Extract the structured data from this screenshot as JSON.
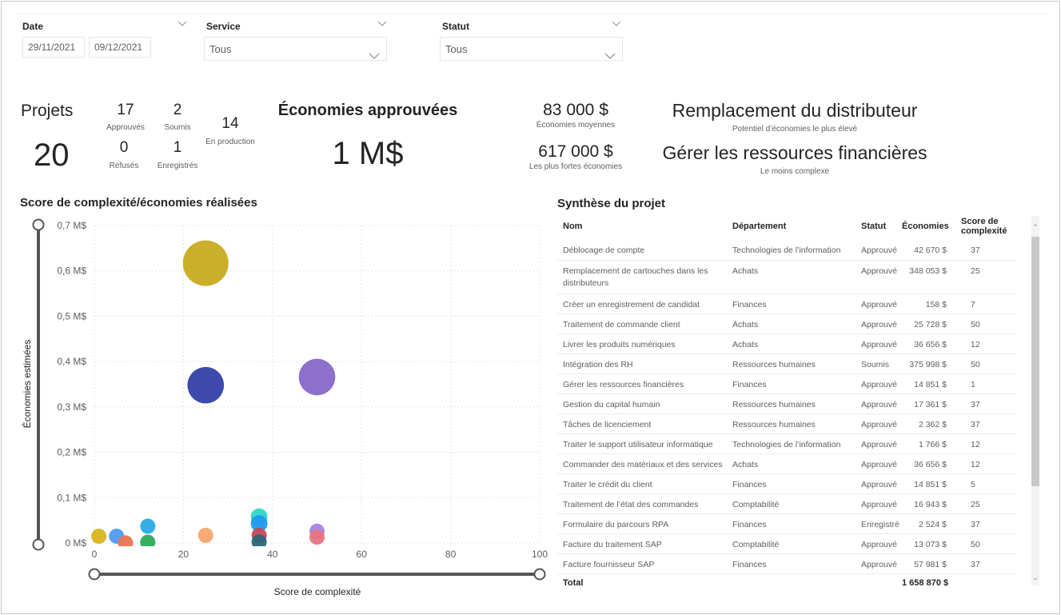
{
  "filters": {
    "date": {
      "title": "Date",
      "start": "29/11/2021",
      "end": "09/12/2021"
    },
    "service": {
      "title": "Service",
      "value": "Tous"
    },
    "statut": {
      "title": "Statut",
      "value": "Tous"
    }
  },
  "kpis": {
    "projets_label": "Projets",
    "projets_total": "20",
    "approuves": {
      "value": "17",
      "label": "Approuvés"
    },
    "soumis": {
      "value": "2",
      "label": "Soumis"
    },
    "refuses": {
      "value": "0",
      "label": "Refusés"
    },
    "enregistres": {
      "value": "1",
      "label": "Enregistrés"
    },
    "en_production": {
      "value": "14",
      "label": "En production"
    },
    "economies_title": "Économies approuvées",
    "economies_value": "1 M$",
    "moyennes": {
      "value": "83 000 $",
      "label": "Économies moyennes"
    },
    "plus_fortes": {
      "value": "617 000 $",
      "label": "Les plus fortes économies"
    },
    "top_potential": {
      "value": "Remplacement du distributeur",
      "label": "Potentiel d’économies le plus élevé"
    },
    "least_complex": {
      "value": "Gérer les ressources financières",
      "label": "Le moins complexe"
    }
  },
  "chart_data": {
    "type": "scatter",
    "title": "Score de complexité/économies réalisées",
    "xlabel": "Score de complexité",
    "ylabel": "Économies estimées",
    "xlim": [
      0,
      100
    ],
    "ylim": [
      0,
      0.7
    ],
    "x_ticks": [
      "0",
      "20",
      "40",
      "60",
      "80",
      "100"
    ],
    "y_ticks": [
      "0 M$",
      "0,1 M$",
      "0,2 M$",
      "0,3 M$",
      "0,4 M$",
      "0,5 M$",
      "0,6 M$",
      "0,7 M$"
    ],
    "grid": true,
    "legend": "none",
    "points": [
      {
        "x": 25,
        "y": 0.617,
        "size": 3,
        "color": "#C8AA1E"
      },
      {
        "x": 25,
        "y": 0.348,
        "size": 2.4,
        "color": "#3340A8"
      },
      {
        "x": 50,
        "y": 0.366,
        "size": 2.4,
        "color": "#8767C9"
      },
      {
        "x": 1,
        "y": 0.015,
        "size": 1,
        "color": "#D9B41E"
      },
      {
        "x": 5,
        "y": 0.015,
        "size": 1,
        "color": "#4E9BF0"
      },
      {
        "x": 7,
        "y": 0.0002,
        "size": 1,
        "color": "#E97552"
      },
      {
        "x": 12,
        "y": 0.037,
        "size": 1,
        "color": "#2AAAE3"
      },
      {
        "x": 12,
        "y": 0.0017,
        "size": 1,
        "color": "#2EAA5A"
      },
      {
        "x": 25,
        "y": 0.017,
        "size": 1,
        "color": "#F6A66D"
      },
      {
        "x": 37,
        "y": 0.058,
        "size": 1.1,
        "color": "#2BD7C3"
      },
      {
        "x": 37,
        "y": 0.043,
        "size": 1.1,
        "color": "#1C9BF0"
      },
      {
        "x": 37,
        "y": 0.017,
        "size": 1,
        "color": "#C8485A"
      },
      {
        "x": 37,
        "y": 0.0024,
        "size": 1,
        "color": "#2A6878"
      },
      {
        "x": 50,
        "y": 0.026,
        "size": 1,
        "color": "#A883E6"
      },
      {
        "x": 50,
        "y": 0.013,
        "size": 1,
        "color": "#E8737F"
      }
    ]
  },
  "table": {
    "title": "Synthèse du projet",
    "headers": [
      "Nom",
      "Département",
      "Statut",
      "Économies",
      "Score de complexité"
    ],
    "rows": [
      [
        "Déblocage de compte",
        "Technologies de l’information",
        "Approuvé",
        "42 670 $",
        "37"
      ],
      [
        "Remplacement de cartouches dans les distributeurs",
        "Achats",
        "Approuvé",
        "348 053 $",
        "25"
      ],
      [
        "Créer un enregistrement de candidat",
        "Finances",
        "Approuvé",
        "158 $",
        "7"
      ],
      [
        "Traitement de commande client",
        "Achats",
        "Approuvé",
        "25 728 $",
        "50"
      ],
      [
        "Livrer les produits numériques",
        "Achats",
        "Approuvé",
        "36 656 $",
        "12"
      ],
      [
        "Intégration des RH",
        "Ressources humaines",
        "Soumis",
        "375 998 $",
        "50"
      ],
      [
        "Gérer les ressources financières",
        "Finances",
        "Approuvé",
        "14 851 $",
        "1"
      ],
      [
        "Gestion du capital humain",
        "Ressources humaines",
        "Approuvé",
        "17 361 $",
        "37"
      ],
      [
        "Tâches de licenciement",
        "Ressources humaines",
        "Approuvé",
        "2 362 $",
        "37"
      ],
      [
        "Traiter le support utilisateur informatique",
        "Technologies de l’information",
        "Approuvé",
        "1 766 $",
        "12"
      ],
      [
        "Commander des matériaux et des services",
        "Achats",
        "Approuvé",
        "36 656 $",
        "12"
      ],
      [
        "Traiter le crédit du client",
        "Finances",
        "Approuvé",
        "14 851 $",
        "5"
      ],
      [
        "Traitement de l’état des commandes",
        "Comptabilité",
        "Approuvé",
        "16 943 $",
        "25"
      ],
      [
        "Formulaire du parcours RPA",
        "Finances",
        "Enregistré",
        "2 524 $",
        "37"
      ],
      [
        "Facture du traitement SAP",
        "Comptabilité",
        "Approuvé",
        "13 073 $",
        "50"
      ],
      [
        "Facture fournisseur SAP",
        "Finances",
        "Approuvé",
        "57 981 $",
        "37"
      ]
    ],
    "total_label": "Total",
    "total_value": "1 658 870 $"
  }
}
